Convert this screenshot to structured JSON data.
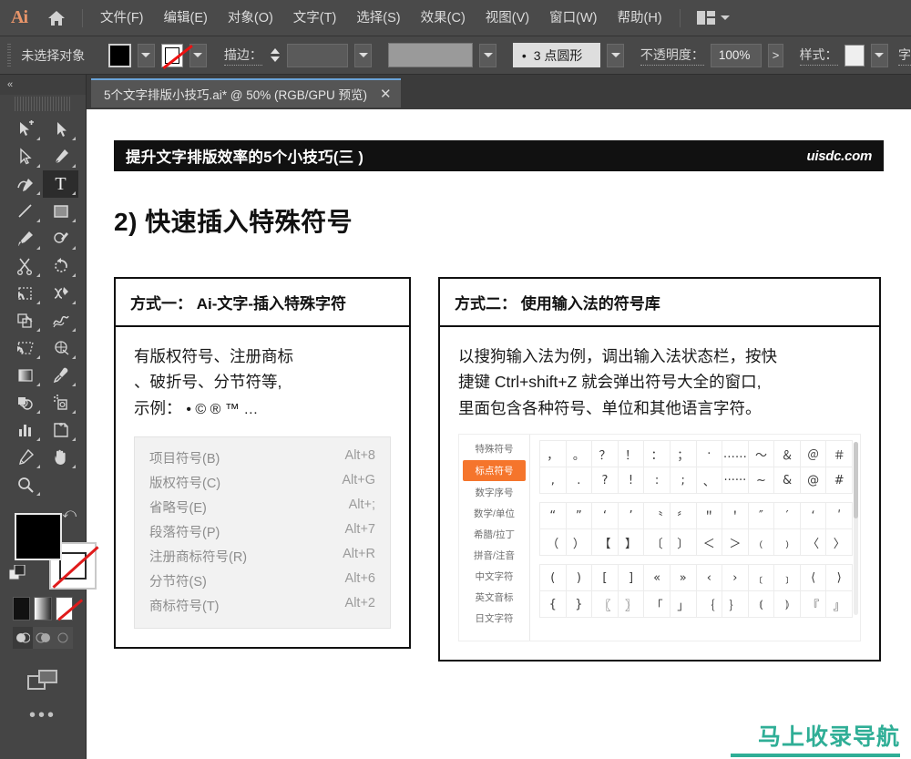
{
  "app": {
    "logo": "Ai",
    "home_icon": "home-icon"
  },
  "menubar": {
    "items": [
      {
        "label": "文件(F)"
      },
      {
        "label": "编辑(E)"
      },
      {
        "label": "对象(O)"
      },
      {
        "label": "文字(T)"
      },
      {
        "label": "选择(S)"
      },
      {
        "label": "效果(C)"
      },
      {
        "label": "视图(V)"
      },
      {
        "label": "窗口(W)"
      },
      {
        "label": "帮助(H)"
      }
    ],
    "arrange_icon": "arrange-documents-icon",
    "arrange_chevron": "chevron-down-icon"
  },
  "controlbar": {
    "selection_status": "未选择对象",
    "fill_label": "fill-swatch",
    "stroke_swatch_label": "stroke-swatch-none",
    "stroke_label": "描边：",
    "stroke_weight_value": "",
    "brush_definition": "",
    "brush_style_value": "3 点圆形",
    "brush_bullet": "•",
    "opacity_label": "不透明度：",
    "opacity_value": "100%",
    "opacity_arrow": ">",
    "style_label": "样式：",
    "char_label": "字"
  },
  "document_tab": {
    "title": "5个文字排版小技巧.ai* @ 50% (RGB/GPU 预览)",
    "close": "✕"
  },
  "toolpanel": {
    "collapse_icon": "double-chevron-left-icon",
    "tools": [
      {
        "name": "selection-tool",
        "icon": "arrow-plus"
      },
      {
        "name": "direct-selection-tool",
        "icon": "arrow"
      },
      {
        "name": "magic-wand-tool",
        "icon": "arrow-outline"
      },
      {
        "name": "pen-tool",
        "icon": "pen"
      },
      {
        "name": "curvature-tool",
        "icon": "curvature"
      },
      {
        "name": "type-tool",
        "icon": "T",
        "selected": true
      },
      {
        "name": "line-segment-tool",
        "icon": "line"
      },
      {
        "name": "rectangle-tool",
        "icon": "rect"
      },
      {
        "name": "paintbrush-tool",
        "icon": "brush"
      },
      {
        "name": "shaper-tool",
        "icon": "shaper"
      },
      {
        "name": "scissors-tool",
        "icon": "scissors"
      },
      {
        "name": "rotate-tool",
        "icon": "rotate"
      },
      {
        "name": "free-transform-tool",
        "icon": "transform"
      },
      {
        "name": "width-tool",
        "icon": "width"
      },
      {
        "name": "shape-builder-tool",
        "icon": "shapebuilder"
      },
      {
        "name": "mesh-tool",
        "icon": "mesh"
      },
      {
        "name": "perspective-grid-tool",
        "icon": "perspective"
      },
      {
        "name": "gradient-mesh-tool",
        "icon": "gridmesh"
      },
      {
        "name": "gradient-tool",
        "icon": "gradient"
      },
      {
        "name": "eyedropper-tool",
        "icon": "eyedropper"
      },
      {
        "name": "blend-tool",
        "icon": "blend"
      },
      {
        "name": "symbol-sprayer-tool",
        "icon": "sprayer"
      },
      {
        "name": "column-graph-tool",
        "icon": "graph"
      },
      {
        "name": "artboard-tool",
        "icon": "artboard"
      },
      {
        "name": "slice-tool",
        "icon": "slice"
      },
      {
        "name": "hand-tool",
        "icon": "hand"
      },
      {
        "name": "zoom-tool",
        "icon": "magnifier"
      }
    ],
    "fill_color": "#000000",
    "stroke_color": "none",
    "swap_icon": "swap-fill-stroke-icon",
    "default_icon": "default-fill-stroke-icon",
    "color_modes": [
      {
        "name": "color-mode-solid",
        "label": ""
      },
      {
        "name": "color-mode-gradient",
        "label": ""
      },
      {
        "name": "color-mode-none",
        "label": ""
      }
    ],
    "draw_modes": [
      {
        "name": "draw-normal-mode",
        "selected": true
      },
      {
        "name": "draw-behind-mode",
        "selected": false
      },
      {
        "name": "draw-inside-mode",
        "selected": false
      }
    ],
    "screen_mode_icon": "change-screen-mode-icon",
    "more_tools": "•••"
  },
  "document": {
    "banner_title": "提升文字排版效率的5个小技巧(三 )",
    "banner_brand": "uisdc.com",
    "section_title": "2) 快速插入特殊符号",
    "cards": [
      {
        "id": "method-one",
        "head": "方式一： Ai-文字-插入特殊字符",
        "body_lines": [
          "有版权符号、注册商标",
          "、破折号、分节符等,"
        ],
        "example_label": "示例：",
        "example_symbols": "• © ® ™  …",
        "menu_items": [
          {
            "label": "项目符号(B)",
            "shortcut": "Alt+8"
          },
          {
            "label": "版权符号(C)",
            "shortcut": "Alt+G"
          },
          {
            "label": "省略号(E)",
            "shortcut": "Alt+;"
          },
          {
            "label": "段落符号(P)",
            "shortcut": "Alt+7"
          },
          {
            "label": "注册商标符号(R)",
            "shortcut": "Alt+R"
          },
          {
            "label": "分节符(S)",
            "shortcut": "Alt+6"
          },
          {
            "label": "商标符号(T)",
            "shortcut": "Alt+2"
          }
        ]
      },
      {
        "id": "method-two",
        "head": "方式二： 使用输入法的符号库",
        "body_lines": [
          "以搜狗输入法为例，调出输入法状态栏，按快",
          "捷键 Ctrl+shift+Z 就会弹出符号大全的窗口,",
          "里面包含各种符号、单位和其他语言字符。"
        ],
        "symbol_panel": {
          "accent_color": "#f5752c",
          "categories": [
            {
              "label": "特殊符号",
              "selected": false
            },
            {
              "label": "标点符号",
              "selected": true
            },
            {
              "label": "数字序号",
              "selected": false
            },
            {
              "label": "数学/单位",
              "selected": false
            },
            {
              "label": "希腊/拉丁",
              "selected": false
            },
            {
              "label": "拼音/注音",
              "selected": false
            },
            {
              "label": "中文字符",
              "selected": false
            },
            {
              "label": "英文音标",
              "selected": false
            },
            {
              "label": "日文字符",
              "selected": false
            }
          ],
          "grids": [
            {
              "rows": [
                [
                  "，",
                  "。",
                  "？",
                  "！",
                  "：",
                  "；",
                  "·",
                  "……",
                  "～",
                  "＆",
                  "＠",
                  "＃"
                ],
                [
                  ",",
                  ".",
                  "?",
                  "!",
                  ":",
                  ";",
                  "、",
                  "······",
                  "~",
                  "&",
                  "@",
                  "#"
                ]
              ]
            },
            {
              "rows": [
                [
                  "“",
                  "”",
                  "‘",
                  "’",
                  "〝",
                  "〞",
                  "＂",
                  "＇",
                  "″",
                  "′",
                  "ʻ",
                  "ʹ"
                ],
                [
                  "（",
                  "）",
                  "【",
                  "】",
                  "〔",
                  "〕",
                  "＜",
                  "＞",
                  "﹙",
                  "﹚",
                  "〈",
                  "〉"
                ]
              ]
            },
            {
              "rows": [
                [
                  "(",
                  ")",
                  "[",
                  "]",
                  "«",
                  "»",
                  "‹",
                  "›",
                  "﹝",
                  "﹞",
                  "⟨",
                  "⟩"
                ],
                [
                  "{",
                  "}",
                  "〖",
                  "〗",
                  "「",
                  "」",
                  "｛",
                  "｝",
                  "⦅",
                  "⦆",
                  "『",
                  "』"
                ]
              ]
            }
          ]
        }
      }
    ]
  },
  "watermark": {
    "text": "马上收录导航",
    "color": "#2fae96"
  }
}
